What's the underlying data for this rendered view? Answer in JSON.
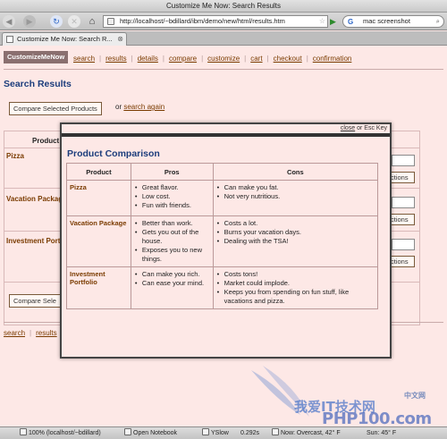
{
  "window": {
    "title": "Customize Me Now: Search Results"
  },
  "toolbar": {
    "url": "http://localhost/~bdillard/ibm/demo/new/html/results.htm",
    "search_query": "mac screenshot"
  },
  "tab": {
    "label": "Customize Me Now: Search R..."
  },
  "site": {
    "logo": "CustomizeMeNow",
    "nav": [
      "search",
      "results",
      "details",
      "compare",
      "customize",
      "cart",
      "checkout",
      "confirmation"
    ]
  },
  "results": {
    "heading": "Search Results",
    "compare_button": "Compare Selected Products",
    "or_text": "or",
    "search_again": "search again",
    "table_header": "Product",
    "rows": [
      "Pizza",
      "Vacation Package",
      "Investment Portfolio"
    ],
    "row_button_fragment": "ctions",
    "bottom_compare_button": "Compare Sele",
    "bottom_nav": [
      "search",
      "results"
    ]
  },
  "modal": {
    "close_link": "close",
    "close_hint": "or Esc Key",
    "title": "Product Comparison",
    "headers": [
      "Product",
      "Pros",
      "Cons"
    ],
    "rows": [
      {
        "product": "Pizza",
        "pros": [
          "Great flavor.",
          "Low cost.",
          "Fun with friends."
        ],
        "cons": [
          "Can make you fat.",
          "Not very nutritious."
        ]
      },
      {
        "product": "Vacation Package",
        "pros": [
          "Better than work.",
          "Gets you out of the house.",
          "Exposes you to new things."
        ],
        "cons": [
          "Costs a lot.",
          "Burns your vacation days.",
          "Dealing with the TSA!"
        ]
      },
      {
        "product": "Investment Portfolio",
        "pros": [
          "Can make you rich.",
          "Can ease your mind."
        ],
        "cons": [
          "Costs tons!",
          "Market could implode.",
          "Keeps you from spending on fun stuff, like vacations and pizza."
        ]
      }
    ]
  },
  "statusbar": {
    "zoom": "100% (localhost/~bdillard)",
    "notebook": "Open Notebook",
    "yslow": "YSlow",
    "time": "0.292s",
    "weather_now": "Now: Overcast, 42° F",
    "weather_sun": "Sun: 45° F"
  },
  "watermark": {
    "line1": "我爱IT技术网",
    "line2": "PHP100.com",
    "small": "中文网"
  },
  "colors": {
    "page_bg": "#fde8e6",
    "link": "#7a3b00",
    "heading": "#1c3d7c",
    "logo_bg": "#8a6f6f"
  }
}
